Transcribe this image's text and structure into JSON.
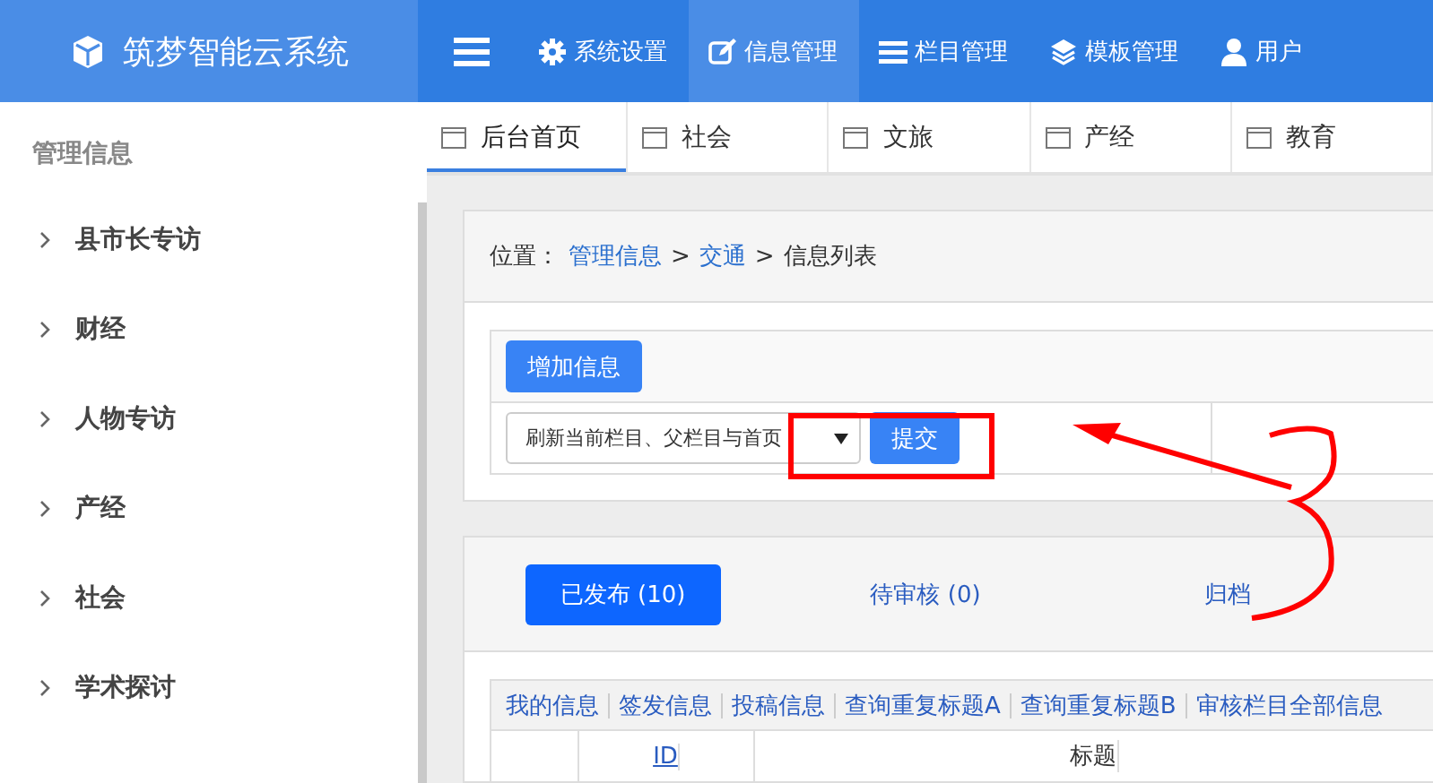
{
  "app": {
    "title": "筑梦智能云系统"
  },
  "nav": [
    {
      "label": "系统设置",
      "selected": false
    },
    {
      "label": "信息管理",
      "selected": true
    },
    {
      "label": "栏目管理",
      "selected": false
    },
    {
      "label": "模板管理",
      "selected": false
    },
    {
      "label": "用户",
      "selected": false
    }
  ],
  "sidebar": {
    "heading": "管理信息",
    "items": [
      "县市长专访",
      "财经",
      "人物专访",
      "产经",
      "社会",
      "学术探讨"
    ]
  },
  "tabs": [
    {
      "label": "后台首页",
      "selected": true
    },
    {
      "label": "社会",
      "selected": false
    },
    {
      "label": "文旅",
      "selected": false
    },
    {
      "label": "产经",
      "selected": false
    },
    {
      "label": "教育",
      "selected": false
    }
  ],
  "breadcrumb": [
    {
      "text": "位置：",
      "kind": "label"
    },
    {
      "text": "管理信息",
      "kind": "link"
    },
    {
      "text": ">",
      "kind": "sep"
    },
    {
      "text": "交通",
      "kind": "link"
    },
    {
      "text": ">",
      "kind": "sep"
    },
    {
      "text": "信息列表",
      "kind": "label"
    }
  ],
  "toolbar": {
    "add_button": "增加信息",
    "select_value": "刷新当前栏目、父栏目与首页",
    "submit_button": "提交"
  },
  "status_tabs": [
    {
      "label": "已发布 (10)",
      "selected": true
    },
    {
      "label": "待审核 (0)",
      "selected": false
    },
    {
      "label": "归档",
      "selected": false
    }
  ],
  "filters": [
    "我的信息",
    "签发信息",
    "投稿信息",
    "查询重复标题A",
    "查询重复标题B",
    "审核栏目全部信息"
  ],
  "table": {
    "columns": [
      {
        "label": "ID",
        "kind": "link"
      },
      {
        "label": "标题",
        "kind": "text"
      }
    ]
  }
}
